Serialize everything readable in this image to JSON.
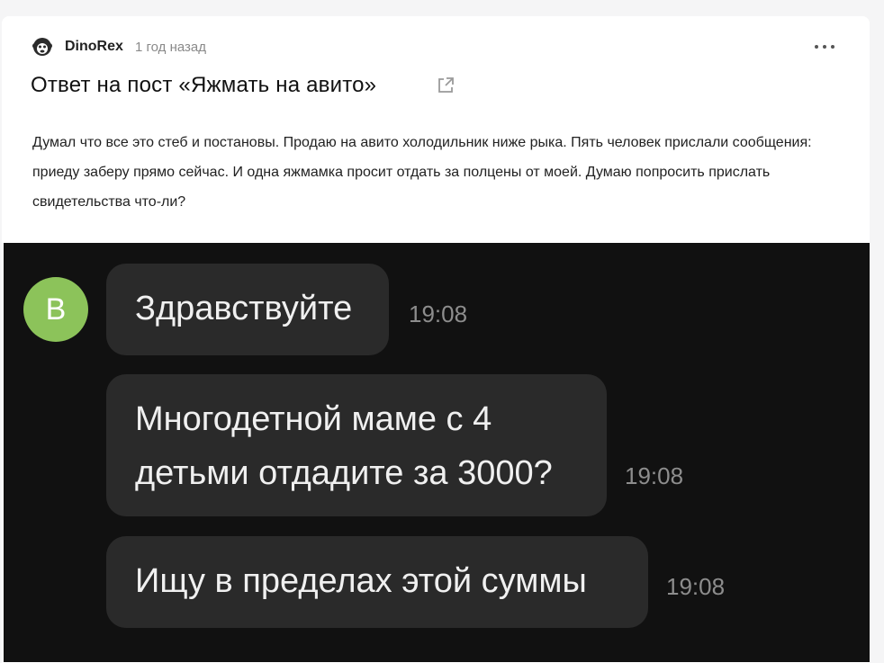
{
  "post": {
    "author": "DinoRex",
    "time_ago": "1 год назад",
    "title": "Ответ на пост «Яжмать на авито»",
    "body": "Думал что все это стеб и постановы. Продаю на авито холодильник ниже рыка. Пять человек прислали сообщения: приеду заберу прямо сейчас. И одна яжмамка просит отдать за полцены от моей. Думаю попросить прислать свидетельства что-ли?",
    "icons": {
      "author_avatar": "monkey-avatar-icon",
      "more": "more-dots-icon",
      "external": "external-link-icon"
    }
  },
  "chat": {
    "avatar_letter": "В",
    "avatar_color": "#8cc35a",
    "messages": [
      {
        "text": "Здравствуйте",
        "time": "19:08"
      },
      {
        "text": "Многодетной маме с 4 детьми отдадите за 3000?",
        "time": "19:08"
      },
      {
        "text": "Ищу в пределах этой суммы",
        "time": "19:08"
      }
    ]
  }
}
